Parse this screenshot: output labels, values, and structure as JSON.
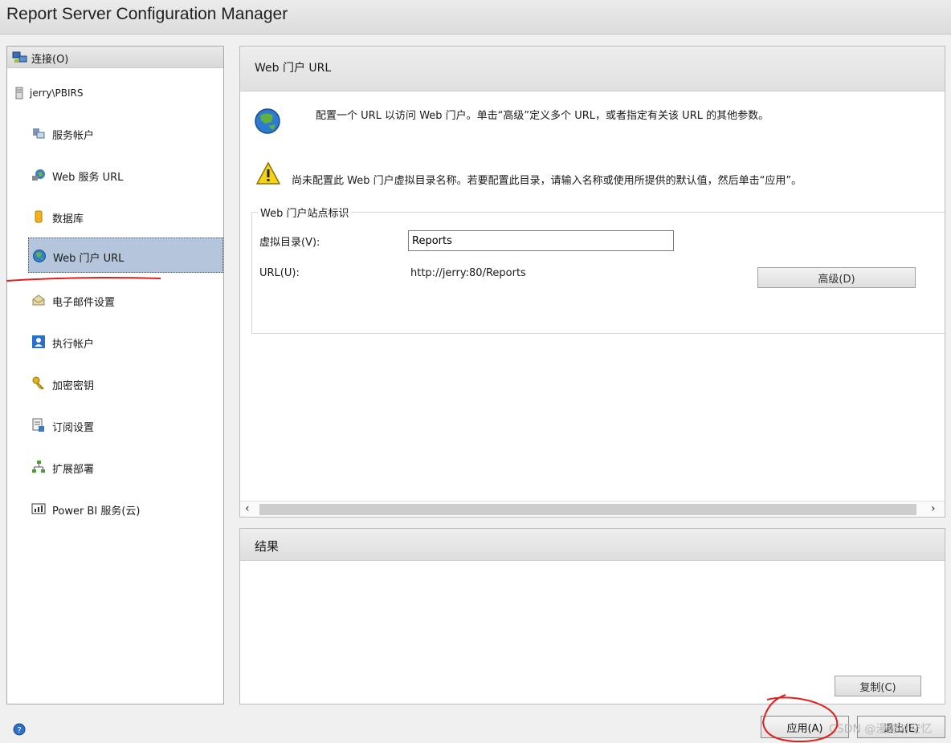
{
  "window": {
    "title": "Report Server Configuration Manager"
  },
  "sidebar": {
    "connect_label": "连接(O)",
    "server": "jerry\\PBIRS",
    "items": [
      {
        "label": "服务帐户",
        "icon": "service-account-icon"
      },
      {
        "label": "Web 服务 URL",
        "icon": "web-service-icon"
      },
      {
        "label": "数据库",
        "icon": "database-icon"
      },
      {
        "label": "Web 门户 URL",
        "icon": "globe-icon",
        "selected": true
      },
      {
        "label": "电子邮件设置",
        "icon": "email-icon"
      },
      {
        "label": "执行帐户",
        "icon": "execution-account-icon"
      },
      {
        "label": "加密密钥",
        "icon": "key-icon"
      },
      {
        "label": "订阅设置",
        "icon": "subscription-icon"
      },
      {
        "label": "扩展部署",
        "icon": "scale-out-icon"
      },
      {
        "label": "Power BI 服务(云)",
        "icon": "power-bi-icon"
      }
    ]
  },
  "main": {
    "title": "Web 门户 URL",
    "description": "配置一个 URL 以访问 Web 门户。单击“高级”定义多个 URL，或者指定有关该 URL 的其他参数。",
    "warning": "尚未配置此 Web 门户虚拟目录名称。若要配置此目录，请输入名称或使用所提供的默认值，然后单击“应用”。",
    "site_group": {
      "legend": "Web 门户站点标识",
      "vdir_label": "虚拟目录(V):",
      "vdir_value": "Reports",
      "url_label": "URL(U):",
      "url_value": "http://jerry:80/Reports",
      "advanced_button": "高级(D)"
    }
  },
  "results": {
    "title": "结果",
    "copy_button": "复制(C)"
  },
  "footer": {
    "apply_button": "应用(A)",
    "exit_button": "退出(E)",
    "watermark": "CSDN @漫游时空忆"
  },
  "colors": {
    "selection": "#b5c6dc",
    "annotation_red": "#e02020"
  }
}
